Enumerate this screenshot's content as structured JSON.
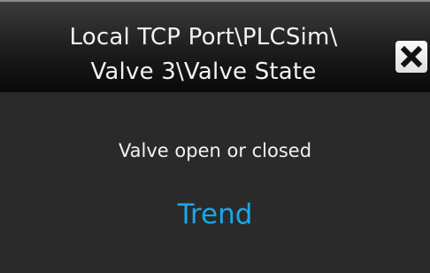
{
  "popup": {
    "title_lines": [
      "Local TCP Port\\PLCSim\\",
      "Valve 3\\Valve State"
    ],
    "close_icon": "close-icon",
    "description": "Valve open or closed",
    "trend_label": "Trend"
  },
  "colors": {
    "background": "#2a2a2a",
    "title_text": "#f2f2f2",
    "link": "#1aa7e8",
    "close_button": "#f0f0f0"
  }
}
